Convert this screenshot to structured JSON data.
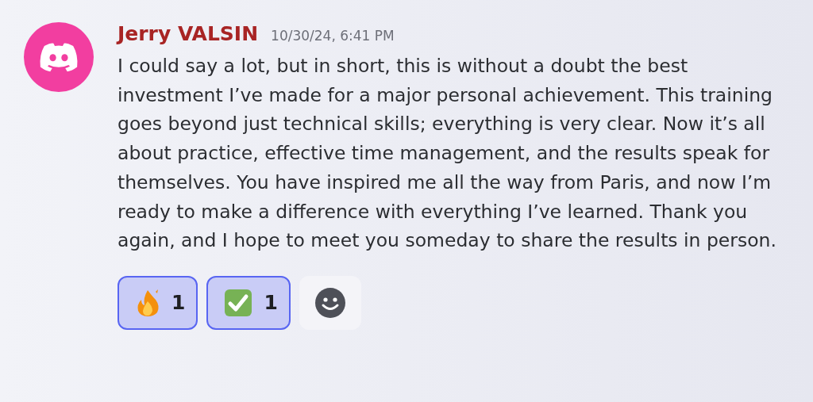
{
  "message": {
    "author": "Jerry VALSIN",
    "timestamp": "10/30/24, 6:41 PM",
    "text": "I could say a lot, but in short, this is without a doubt the best investment I’ve made for a major personal achievement. This training goes beyond just technical skills; everything is very clear. Now it’s all about practice, effective time management, and the results speak for themselves. You have inspired me all the way from Paris, and now I’m ready to make a difference with everything I’ve learned. Thank you again, and I hope to meet you someday to share the results in person.",
    "reactions": [
      {
        "kind": "fire",
        "count": "1",
        "selected": true
      },
      {
        "kind": "check",
        "count": "1",
        "selected": true
      }
    ]
  }
}
